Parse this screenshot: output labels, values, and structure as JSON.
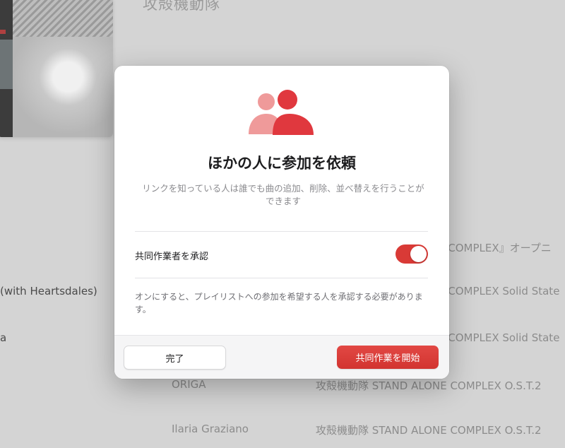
{
  "background": {
    "album_title": "攻殻機動隊",
    "rows": [
      {
        "col1": "",
        "col2": "E COMPLEX』オープニ"
      },
      {
        "col1": "(with Heartsdales)",
        "col2": "E COMPLEX Solid State"
      },
      {
        "col1": "a",
        "col2": "E COMPLEX Solid State"
      },
      {
        "col1": "ORIGA",
        "col2": "攻殻機動隊 STAND ALONE COMPLEX O.S.T.2"
      },
      {
        "col1": "Ilaria Graziano",
        "col2": "攻殻機動隊 STAND ALONE COMPLEX O.S.T.2"
      }
    ]
  },
  "modal": {
    "icon": "people-icon",
    "title": "ほかの人に参加を依頼",
    "description": "リンクを知っている人は誰でも曲の追加、削除、並べ替えを行うことができます",
    "approve_label": "共同作業者を承認",
    "approve_toggle_on": true,
    "help_text": "オンにすると、プレイリストへの参加を希望する人を承認する必要があります。",
    "done_button": "完了",
    "start_button": "共同作業を開始"
  },
  "colors": {
    "accent": "#d93a36",
    "icon_light": "#ef9a9a",
    "icon_dark": "#e0383e",
    "background_dim": "#d4d4d4"
  }
}
